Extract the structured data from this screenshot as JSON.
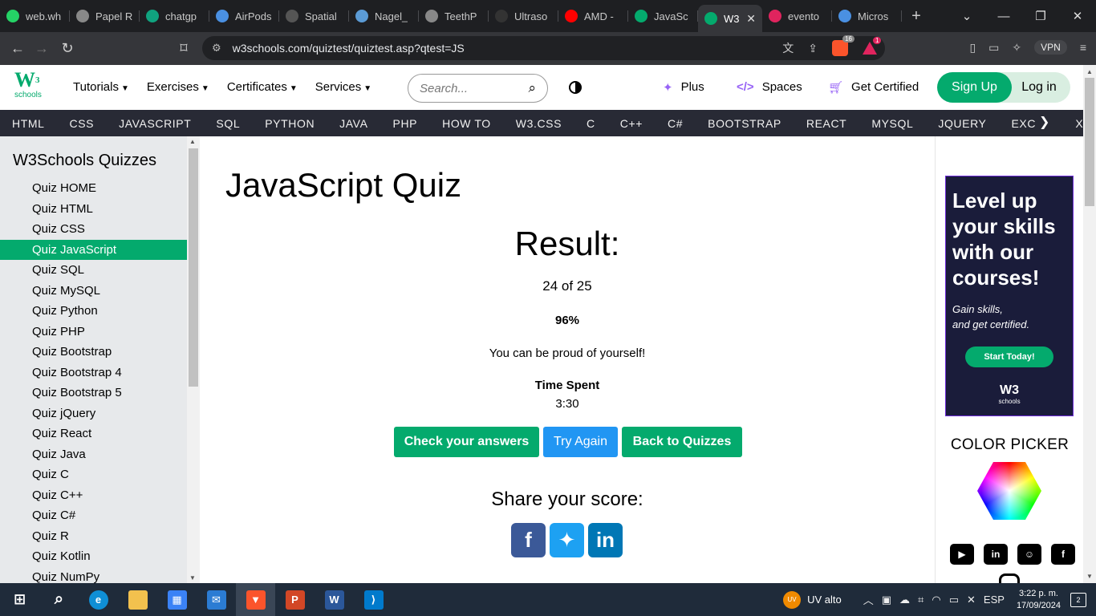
{
  "browser": {
    "tabs": [
      {
        "title": "web.wh",
        "icon": "whatsapp-icon",
        "color": "#25d366"
      },
      {
        "title": "Papel R",
        "icon": "globe-icon",
        "color": "#888888"
      },
      {
        "title": "chatgp",
        "icon": "openai-icon",
        "color": "#10a37f"
      },
      {
        "title": "AirPods",
        "icon": "airpods-icon",
        "color": "#4a90e2"
      },
      {
        "title": "Spatial",
        "icon": "ut-icon",
        "color": "#555555"
      },
      {
        "title": "Nagel_",
        "icon": "doc-icon",
        "color": "#5b9bd5"
      },
      {
        "title": "TeethP",
        "icon": "globe-icon",
        "color": "#888888"
      },
      {
        "title": "Ultraso",
        "icon": "ultrasound-icon",
        "color": "#333333"
      },
      {
        "title": "AMD -",
        "icon": "youtube-icon",
        "color": "#ff0000"
      },
      {
        "title": "JavaSc",
        "icon": "w3-icon",
        "color": "#04aa6d"
      },
      {
        "title": "W3",
        "icon": "w3-icon",
        "color": "#04aa6d",
        "active": true
      },
      {
        "title": "evento",
        "icon": "record-icon",
        "color": "#e0245e"
      },
      {
        "title": "Micros",
        "icon": "microsoft-icon",
        "color": "#4a90e2"
      }
    ],
    "url": "w3schools.com/quiztest/quiztest.asp?qtest=JS",
    "brave_shields_count": "16",
    "rewards_count": "1",
    "vpn_label": "VPN"
  },
  "header": {
    "logo_main": "W",
    "logo_sup": "3",
    "logo_sub": "schools",
    "nav": [
      "Tutorials",
      "Exercises",
      "Certificates",
      "Services"
    ],
    "search_placeholder": "Search...",
    "plus": "Plus",
    "spaces": "Spaces",
    "get_certified": "Get Certified",
    "signup": "Sign Up",
    "login": "Log in"
  },
  "subnav": [
    "HTML",
    "CSS",
    "JAVASCRIPT",
    "SQL",
    "PYTHON",
    "JAVA",
    "PHP",
    "HOW TO",
    "W3.CSS",
    "C",
    "C++",
    "C#",
    "BOOTSTRAP",
    "REACT",
    "MYSQL",
    "JQUERY",
    "EXCEL",
    "XML"
  ],
  "sidebar": {
    "title": "W3Schools Quizzes",
    "items": [
      "Quiz HOME",
      "Quiz HTML",
      "Quiz CSS",
      "Quiz JavaScript",
      "Quiz SQL",
      "Quiz MySQL",
      "Quiz Python",
      "Quiz PHP",
      "Quiz Bootstrap",
      "Quiz Bootstrap 4",
      "Quiz Bootstrap 5",
      "Quiz jQuery",
      "Quiz React",
      "Quiz Java",
      "Quiz C",
      "Quiz C++",
      "Quiz C#",
      "Quiz R",
      "Quiz Kotlin",
      "Quiz NumPy"
    ],
    "active_index": 3
  },
  "main": {
    "title": "JavaScript Quiz",
    "result_label": "Result:",
    "score": "24 of 25",
    "percent": "96%",
    "message": "You can be proud of yourself!",
    "time_label": "Time Spent",
    "time_value": "3:30",
    "btn_check": "Check your answers",
    "btn_try": "Try Again",
    "btn_back": "Back to Quizzes",
    "share_label": "Share your score:"
  },
  "right": {
    "ad_headline": "Level up your skills with our courses!",
    "ad_sub1": "Gain skills,",
    "ad_sub2": "and get certified.",
    "ad_button": "Start Today!",
    "ad_logo": "W3",
    "ad_logo_sub": "schools",
    "color_picker_title": "COLOR PICKER"
  },
  "taskbar": {
    "weather": "UV alto",
    "weather_badge": "UV",
    "lang": "ESP",
    "time": "3:22 p. m.",
    "date": "17/09/2024",
    "notifications": "2"
  },
  "colors": {
    "accent": "#04aa6d",
    "try_again": "#2196f3",
    "subnav_bg": "#282a35",
    "sidebar_bg": "#e7e9eb",
    "facebook": "#3b5998",
    "twitter": "#1da1f2",
    "linkedin": "#0077b5"
  }
}
